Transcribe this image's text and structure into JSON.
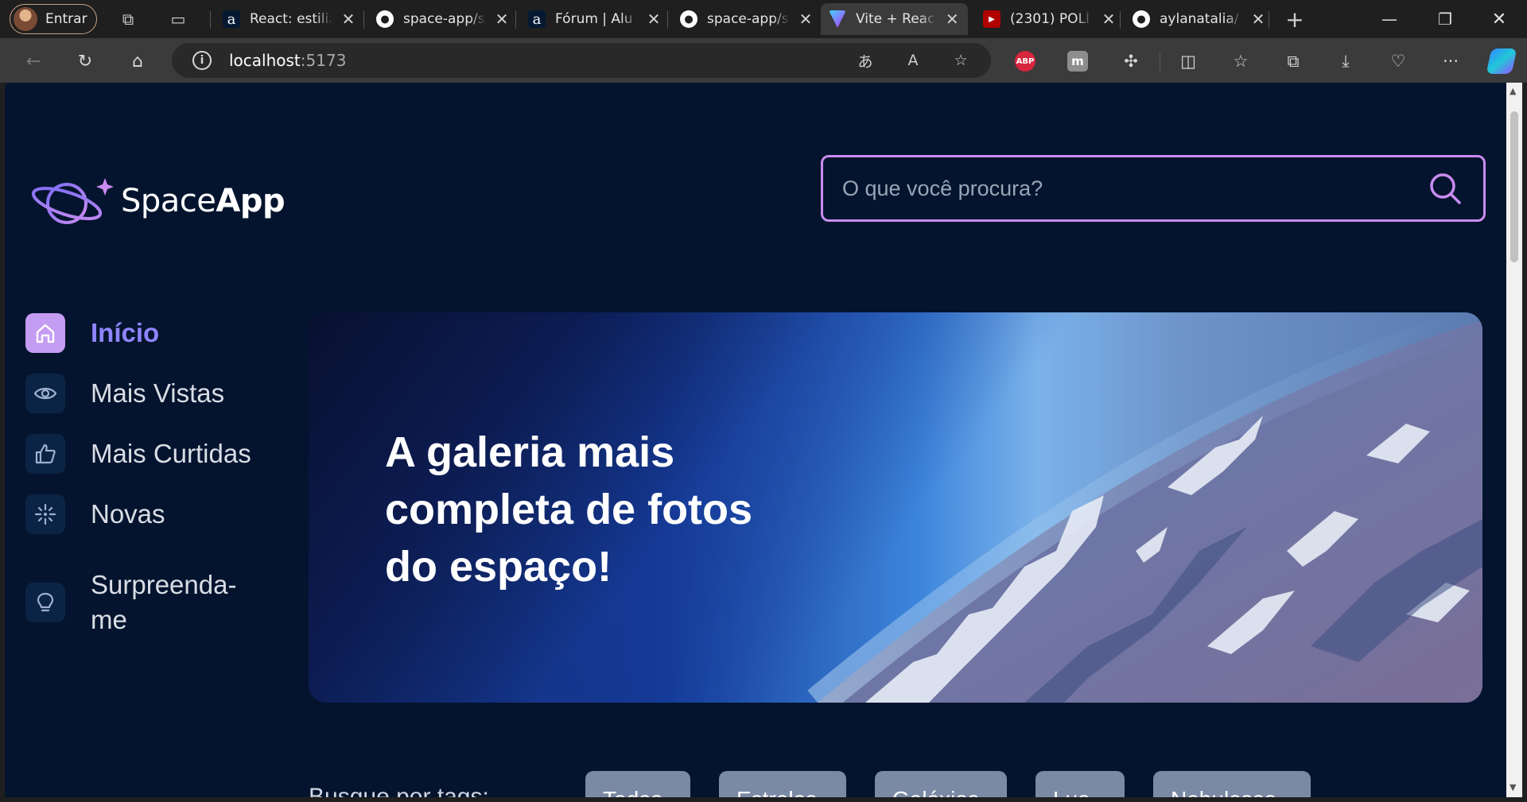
{
  "browser": {
    "profile_label": "Entrar",
    "tabs": [
      {
        "title": "React: estiliz",
        "favicon": "alura-icon",
        "active": false
      },
      {
        "title": "space-app/s",
        "favicon": "github-icon",
        "active": false
      },
      {
        "title": "Fórum | Alu",
        "favicon": "alura-icon",
        "active": false
      },
      {
        "title": "space-app/s",
        "favicon": "github-icon",
        "active": false
      },
      {
        "title": "Vite + Reac",
        "favicon": "vite-icon",
        "active": true
      },
      {
        "title": "(2301) POLÍ",
        "favicon": "youtube-icon",
        "active": false
      },
      {
        "title": "aylanatalia/",
        "favicon": "github-icon",
        "active": false
      }
    ],
    "url_host": "localhost",
    "url_port": ":5173",
    "extensions": {
      "abp_label": "ABP",
      "mx_label": "m"
    }
  },
  "app": {
    "brand_prefix": "Space",
    "brand_suffix": "App",
    "search_placeholder": "O que você procura?",
    "nav": [
      {
        "label": "Início",
        "icon": "home-icon",
        "active": true
      },
      {
        "label": "Mais Vistas",
        "icon": "eye-icon",
        "active": false
      },
      {
        "label": "Mais Curtidas",
        "icon": "thumbs-up-icon",
        "active": false
      },
      {
        "label": "Novas",
        "icon": "sparkle-icon",
        "active": false
      },
      {
        "label": "Surpreenda-me",
        "icon": "lightbulb-icon",
        "active": false
      }
    ],
    "banner_headline": "A galeria mais completa de fotos do espaço!",
    "tags_label": "Busque por tags:",
    "tags": [
      "Todas",
      "Estrelas",
      "Galáxias",
      "Lua",
      "Nebulosas"
    ]
  },
  "colors": {
    "page_bg": "#04142e",
    "accent_purple": "#c98cf1",
    "active_nav_text": "#8f85ff"
  }
}
